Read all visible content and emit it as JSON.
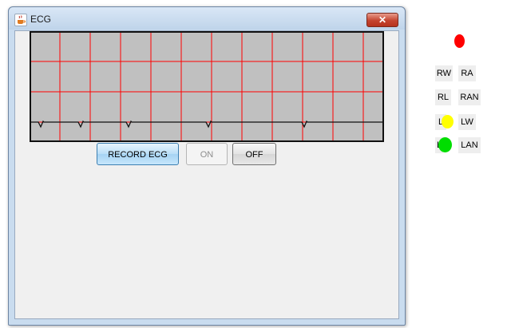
{
  "window": {
    "title": "ECG",
    "close_label": "✕"
  },
  "buttons": {
    "record_label": "RECORD ECG",
    "on_label": "ON",
    "off_label": "OFF"
  },
  "leads": {
    "rw": "RW",
    "ra": "RA",
    "rl": "RL",
    "ran": "RAN",
    "l_partial": "L",
    "lw": "LW",
    "la_partial": "L",
    "lan": "LAN"
  },
  "colors": {
    "grid_line": "#ff0000",
    "plot_background": "#c0c0c0",
    "indicator_red": "#ff0000",
    "indicator_yellow": "#ffff00",
    "indicator_green": "#00dd00"
  },
  "icons": {
    "app": "java-coffee-cup-icon",
    "close": "close-icon"
  }
}
